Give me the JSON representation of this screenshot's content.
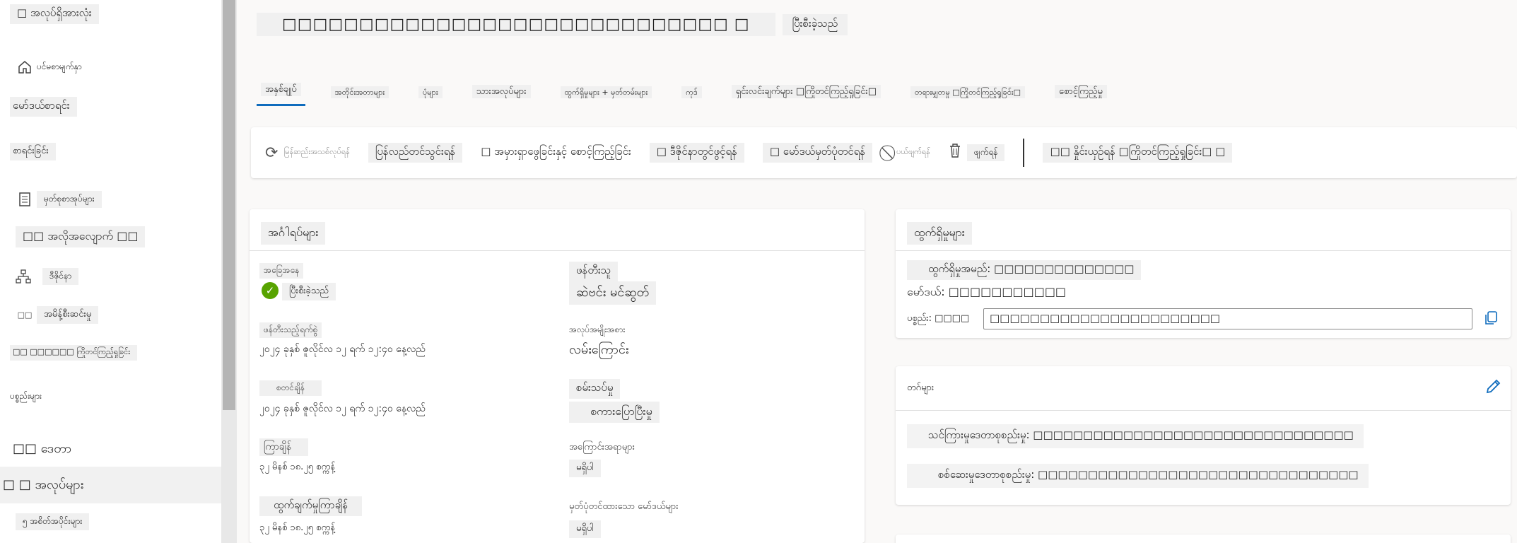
{
  "sidebar": {
    "all_resources": "□ အလုပ်ရှိအားလုံး",
    "items": [
      {
        "label": "ပင်မစာမျက်နှာ",
        "icon": "home-icon"
      },
      {
        "label": "မော်ဒယ်စာရင်း",
        "icon": ""
      },
      {
        "label": "စာရင်းခြင်း",
        "icon": ""
      },
      {
        "label": "မှတ်စုစာအုပ်များ",
        "icon": "notebook-icon"
      },
      {
        "label": "□□ အလိုအလျောက် □□",
        "icon": ""
      },
      {
        "label": "ဒီဇိုင်နာ",
        "icon": "designer-icon"
      },
      {
        "label": "အမိန့်စီးဆင်းမှု",
        "icon": "flow-icon"
      },
      {
        "label": "□□ □□□□□□ ကြိုတင်ကြည့်ရှုခြင်း",
        "icon": ""
      },
      {
        "label": "ပစ္စည်းများ",
        "icon": ""
      },
      {
        "label": "□□ ဒေတာ",
        "icon": ""
      },
      {
        "label": "□ □ အလုပ်များ",
        "icon": ""
      },
      {
        "label": "၅ အစိတ်အပိုင်းများ",
        "icon": ""
      }
    ]
  },
  "header": {
    "title": "□□□□□□□□□□□□□□□□□□□□□□□□□□□□□ □",
    "status": "ပြီးစီးခဲ့သည်"
  },
  "tabs": [
    "အနှစ်ချုပ်",
    "အတိုင်းအတာများ",
    "ပုံများ",
    "သားအလုပ်များ",
    "ထွက်ရှိမှုများ + မှတ်တမ်းများ",
    "ကုဒ်",
    "ရှင်းလင်းချက်များ □ကြိုတင်ကြည့်ရှုခြင်း□",
    "တရားမျှတမှု □ကြိုတင်ကြည့်ရှုခြင်း□",
    "စောင့်ကြည့်မှု"
  ],
  "toolbar": {
    "refresh": "မြန်ဆည်းအသစ်လုပ်ရန်",
    "resubmit": "ပြန်လည်တင်သွင်းရန်",
    "compare": "□ အမှားရှာဖွေခြင်းနှင့် စောင့်ကြည့်ခြင်း",
    "designer": "□ ဒီဇိုင်နာတွင်ဖွင့်ရန်",
    "register": "□ မော်ဒယ်မှတ်ပုံတင်ရန်",
    "cancel": "ပယ်ဖျက်ရန်",
    "delete": "ဖျက်ရန်",
    "compare_preview": "□□ နှိုင်းယှဉ်ရန် □ကြိုတင်ကြည့်ရှုခြင်း□ □"
  },
  "properties": {
    "title": "အင်္ဂါရပ်များ",
    "status_label": "အခြေအနေ",
    "status_value": "ပြီးစီးခဲ့သည်",
    "creator_label": "ဖန်တီးသူ",
    "creator_value": "ဆဲဗင်း မင်ဆွတ်",
    "created_label": "ဖန်တီးသည့်ရက်စွဲ",
    "created_value": "၂၀၂၄ ခုနှစ် ဇူလိုင်လ ၁၂ ရက် ၁၂:၄၀ နေ့လည်",
    "type_label": "အလုပ်အမျိုးအစား",
    "type_value": "လမ်းကြောင်း",
    "start_label": "စတင်ချိန်",
    "start_value": "၂၀၂၄ ခုနှစ် ဇူလိုင်လ ၁၂ ရက် ၁၂:၄၀ နေ့လည်",
    "env_label": "စမ်းသပ်မှု",
    "env_value": "စကားပြောပြီးမှု",
    "duration_label": "ကြာချိန်",
    "duration_value": "၃၂ မိနစ် ၁၈.၂၅ စက္ကန့်",
    "compute_label": "အကြောင်းအရာများ",
    "compute_value": "မရှိပါ",
    "last_label": "ထွက်ချက်မှုကြာချိန်",
    "last_value": "၃၂ မိနစ် ၁၈.၂၅ စက္ကန့်",
    "registered_label": "မှတ်ပုံတင်ထားသော မော်ဒယ်များ",
    "registered_value": "မရှိပါ"
  },
  "outputs": {
    "title": "ထွက်ရှိမှုများ",
    "name_label": "ထွက်ရှိမှုအမည်: □□□□□□□□□□□□□□",
    "model_label": "မော်ဒယ်: □□□□□□□□□□□",
    "asset_label": "ပစ္စည်း: □□□□",
    "asset_value": "□□□□□□□□□□□□□□□□□□□□□□□"
  },
  "tags": {
    "title": "တဂ်များ",
    "training": "သင်ကြားမှုဒေတာစုစည်းမှု: □□□□□□□□□□□□□□□□□□□□□□□□□□□□□□□□",
    "validation": "စစ်ဆေးမှုဒေတာစုစည်းမှု: □□□□□□□□□□□□□□□□□□□□□□□□□□□□□□□□"
  },
  "colors": {
    "accent": "#0f6cbd",
    "success": "#57a300"
  }
}
